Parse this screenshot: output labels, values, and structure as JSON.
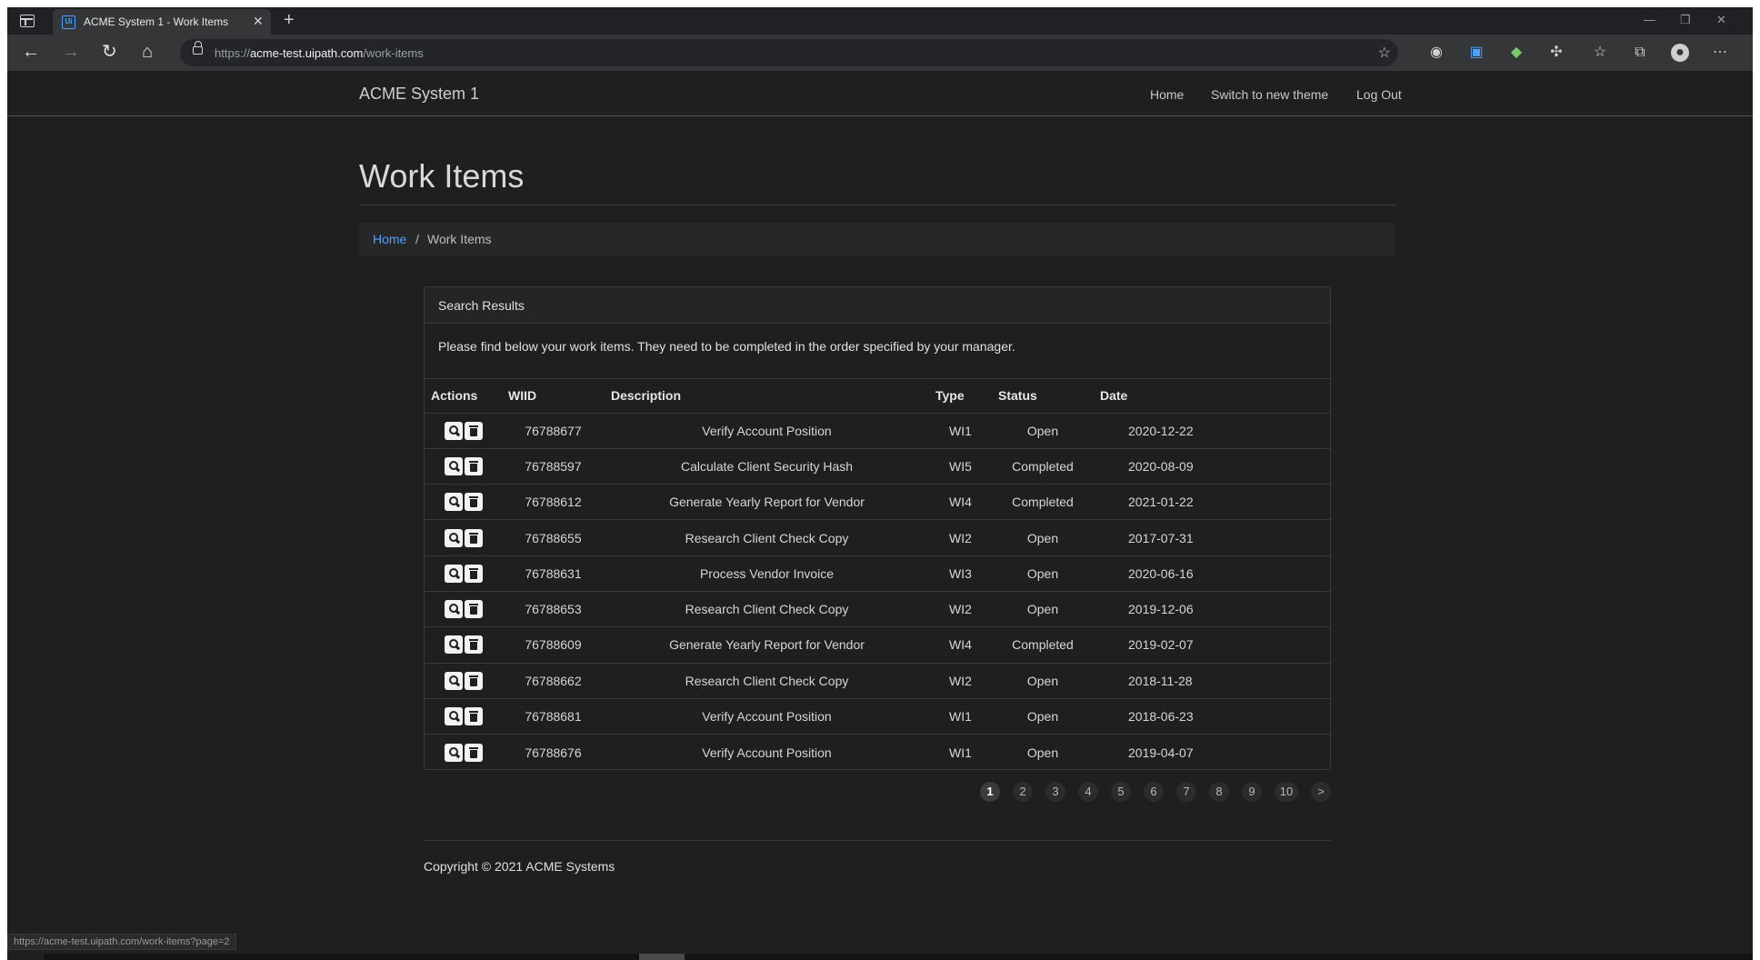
{
  "browser": {
    "tab_title": "ACME System 1 - Work Items",
    "favicon_text": "Ui",
    "url_prefix": "https://",
    "url_host": "acme-test.uipath.com",
    "url_path": "/work-items",
    "status_url": "https://acme-test.uipath.com/work-items?page=2"
  },
  "navbar": {
    "brand": "ACME System 1",
    "links": [
      "Home",
      "Switch to new theme",
      "Log Out"
    ]
  },
  "page": {
    "title": "Work Items",
    "breadcrumb": {
      "home": "Home",
      "separator": "/",
      "current": "Work Items"
    },
    "panel_title": "Search Results",
    "panel_text": "Please find below your work items. They need to be completed in the order specified by your manager."
  },
  "table": {
    "headers": [
      "Actions",
      "WIID",
      "Description",
      "Type",
      "Status",
      "Date"
    ],
    "rows": [
      [
        "76788677",
        "Verify Account Position",
        "WI1",
        "Open",
        "2020-12-22"
      ],
      [
        "76788597",
        "Calculate Client Security Hash",
        "WI5",
        "Completed",
        "2020-08-09"
      ],
      [
        "76788612",
        "Generate Yearly Report for Vendor",
        "WI4",
        "Completed",
        "2021-01-22"
      ],
      [
        "76788655",
        "Research Client Check Copy",
        "WI2",
        "Open",
        "2017-07-31"
      ],
      [
        "76788631",
        "Process Vendor Invoice",
        "WI3",
        "Open",
        "2020-06-16"
      ],
      [
        "76788653",
        "Research Client Check Copy",
        "WI2",
        "Open",
        "2019-12-06"
      ],
      [
        "76788609",
        "Generate Yearly Report for Vendor",
        "WI4",
        "Completed",
        "2019-02-07"
      ],
      [
        "76788662",
        "Research Client Check Copy",
        "WI2",
        "Open",
        "2018-11-28"
      ],
      [
        "76788681",
        "Verify Account Position",
        "WI1",
        "Open",
        "2018-06-23"
      ],
      [
        "76788676",
        "Verify Account Position",
        "WI1",
        "Open",
        "2019-04-07"
      ]
    ]
  },
  "pagination": {
    "pages": [
      "1",
      "2",
      "3",
      "4",
      "5",
      "6",
      "7",
      "8",
      "9",
      "10",
      ">"
    ],
    "active": "1"
  },
  "footer": {
    "copyright": "Copyright © 2021 ACME Systems"
  },
  "colors": {
    "background": "#1e1f21",
    "link": "#4aa3ff",
    "text": "#d6d6d6"
  }
}
